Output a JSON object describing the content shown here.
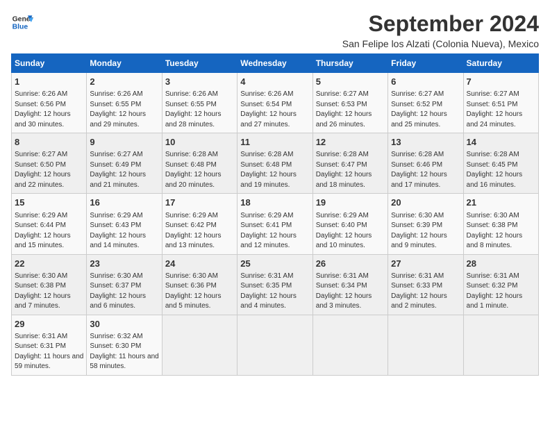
{
  "header": {
    "logo_line1": "General",
    "logo_line2": "Blue",
    "title": "September 2024",
    "subtitle": "San Felipe los Alzati (Colonia Nueva), Mexico"
  },
  "weekdays": [
    "Sunday",
    "Monday",
    "Tuesday",
    "Wednesday",
    "Thursday",
    "Friday",
    "Saturday"
  ],
  "weeks": [
    [
      {
        "day": "1",
        "sunrise": "Sunrise: 6:26 AM",
        "sunset": "Sunset: 6:56 PM",
        "daylight": "Daylight: 12 hours and 30 minutes."
      },
      {
        "day": "2",
        "sunrise": "Sunrise: 6:26 AM",
        "sunset": "Sunset: 6:55 PM",
        "daylight": "Daylight: 12 hours and 29 minutes."
      },
      {
        "day": "3",
        "sunrise": "Sunrise: 6:26 AM",
        "sunset": "Sunset: 6:55 PM",
        "daylight": "Daylight: 12 hours and 28 minutes."
      },
      {
        "day": "4",
        "sunrise": "Sunrise: 6:26 AM",
        "sunset": "Sunset: 6:54 PM",
        "daylight": "Daylight: 12 hours and 27 minutes."
      },
      {
        "day": "5",
        "sunrise": "Sunrise: 6:27 AM",
        "sunset": "Sunset: 6:53 PM",
        "daylight": "Daylight: 12 hours and 26 minutes."
      },
      {
        "day": "6",
        "sunrise": "Sunrise: 6:27 AM",
        "sunset": "Sunset: 6:52 PM",
        "daylight": "Daylight: 12 hours and 25 minutes."
      },
      {
        "day": "7",
        "sunrise": "Sunrise: 6:27 AM",
        "sunset": "Sunset: 6:51 PM",
        "daylight": "Daylight: 12 hours and 24 minutes."
      }
    ],
    [
      {
        "day": "8",
        "sunrise": "Sunrise: 6:27 AM",
        "sunset": "Sunset: 6:50 PM",
        "daylight": "Daylight: 12 hours and 22 minutes."
      },
      {
        "day": "9",
        "sunrise": "Sunrise: 6:27 AM",
        "sunset": "Sunset: 6:49 PM",
        "daylight": "Daylight: 12 hours and 21 minutes."
      },
      {
        "day": "10",
        "sunrise": "Sunrise: 6:28 AM",
        "sunset": "Sunset: 6:48 PM",
        "daylight": "Daylight: 12 hours and 20 minutes."
      },
      {
        "day": "11",
        "sunrise": "Sunrise: 6:28 AM",
        "sunset": "Sunset: 6:48 PM",
        "daylight": "Daylight: 12 hours and 19 minutes."
      },
      {
        "day": "12",
        "sunrise": "Sunrise: 6:28 AM",
        "sunset": "Sunset: 6:47 PM",
        "daylight": "Daylight: 12 hours and 18 minutes."
      },
      {
        "day": "13",
        "sunrise": "Sunrise: 6:28 AM",
        "sunset": "Sunset: 6:46 PM",
        "daylight": "Daylight: 12 hours and 17 minutes."
      },
      {
        "day": "14",
        "sunrise": "Sunrise: 6:28 AM",
        "sunset": "Sunset: 6:45 PM",
        "daylight": "Daylight: 12 hours and 16 minutes."
      }
    ],
    [
      {
        "day": "15",
        "sunrise": "Sunrise: 6:29 AM",
        "sunset": "Sunset: 6:44 PM",
        "daylight": "Daylight: 12 hours and 15 minutes."
      },
      {
        "day": "16",
        "sunrise": "Sunrise: 6:29 AM",
        "sunset": "Sunset: 6:43 PM",
        "daylight": "Daylight: 12 hours and 14 minutes."
      },
      {
        "day": "17",
        "sunrise": "Sunrise: 6:29 AM",
        "sunset": "Sunset: 6:42 PM",
        "daylight": "Daylight: 12 hours and 13 minutes."
      },
      {
        "day": "18",
        "sunrise": "Sunrise: 6:29 AM",
        "sunset": "Sunset: 6:41 PM",
        "daylight": "Daylight: 12 hours and 12 minutes."
      },
      {
        "day": "19",
        "sunrise": "Sunrise: 6:29 AM",
        "sunset": "Sunset: 6:40 PM",
        "daylight": "Daylight: 12 hours and 10 minutes."
      },
      {
        "day": "20",
        "sunrise": "Sunrise: 6:30 AM",
        "sunset": "Sunset: 6:39 PM",
        "daylight": "Daylight: 12 hours and 9 minutes."
      },
      {
        "day": "21",
        "sunrise": "Sunrise: 6:30 AM",
        "sunset": "Sunset: 6:38 PM",
        "daylight": "Daylight: 12 hours and 8 minutes."
      }
    ],
    [
      {
        "day": "22",
        "sunrise": "Sunrise: 6:30 AM",
        "sunset": "Sunset: 6:38 PM",
        "daylight": "Daylight: 12 hours and 7 minutes."
      },
      {
        "day": "23",
        "sunrise": "Sunrise: 6:30 AM",
        "sunset": "Sunset: 6:37 PM",
        "daylight": "Daylight: 12 hours and 6 minutes."
      },
      {
        "day": "24",
        "sunrise": "Sunrise: 6:30 AM",
        "sunset": "Sunset: 6:36 PM",
        "daylight": "Daylight: 12 hours and 5 minutes."
      },
      {
        "day": "25",
        "sunrise": "Sunrise: 6:31 AM",
        "sunset": "Sunset: 6:35 PM",
        "daylight": "Daylight: 12 hours and 4 minutes."
      },
      {
        "day": "26",
        "sunrise": "Sunrise: 6:31 AM",
        "sunset": "Sunset: 6:34 PM",
        "daylight": "Daylight: 12 hours and 3 minutes."
      },
      {
        "day": "27",
        "sunrise": "Sunrise: 6:31 AM",
        "sunset": "Sunset: 6:33 PM",
        "daylight": "Daylight: 12 hours and 2 minutes."
      },
      {
        "day": "28",
        "sunrise": "Sunrise: 6:31 AM",
        "sunset": "Sunset: 6:32 PM",
        "daylight": "Daylight: 12 hours and 1 minute."
      }
    ],
    [
      {
        "day": "29",
        "sunrise": "Sunrise: 6:31 AM",
        "sunset": "Sunset: 6:31 PM",
        "daylight": "Daylight: 11 hours and 59 minutes."
      },
      {
        "day": "30",
        "sunrise": "Sunrise: 6:32 AM",
        "sunset": "Sunset: 6:30 PM",
        "daylight": "Daylight: 11 hours and 58 minutes."
      },
      null,
      null,
      null,
      null,
      null
    ]
  ]
}
